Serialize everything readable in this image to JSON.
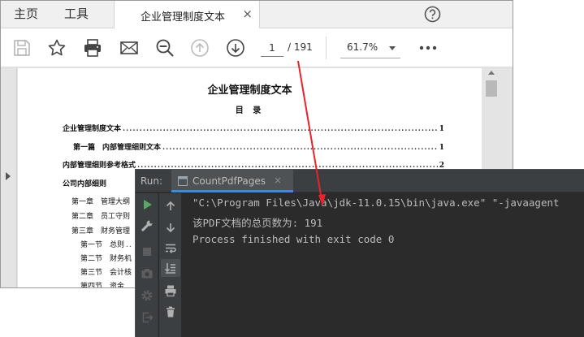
{
  "pdf_reader": {
    "menu": {
      "home_label": "主页",
      "tools_label": "工具"
    },
    "tab": {
      "title": "企业管理制度文本",
      "close_glyph": "×"
    },
    "toolbar": {
      "page_current": "1",
      "page_total": "/ 191",
      "zoom": "61.7%"
    },
    "document": {
      "title": "企业管理制度文本",
      "subtitle": "目 录",
      "toc": [
        {
          "text": "企业管理制度文本",
          "dots": "..........................................................................................................................................",
          "page": "1"
        },
        {
          "text": "第一篇　内部管理细则文本",
          "dots": "..........................................................................................................................................",
          "page": "1"
        },
        {
          "text": "内部管理细则参考格式",
          "dots": "..........................................................................................................................................",
          "page": "2"
        },
        {
          "text": "公司内部细则",
          "dots": "",
          "page": ""
        },
        {
          "text": "第一章　管理大纲",
          "dots": "",
          "page": ""
        },
        {
          "text": "第二章　员工守则",
          "dots": "",
          "page": ""
        },
        {
          "text": "第三章　财务管理",
          "dots": "",
          "page": ""
        },
        {
          "text": "第一节　总则",
          "dots": "..",
          "page": ""
        },
        {
          "text": "第二节　财务机",
          "dots": "",
          "page": ""
        },
        {
          "text": "第三节　会计核",
          "dots": "",
          "page": ""
        },
        {
          "text": "第四节　资金",
          "dots": "",
          "page": ""
        }
      ]
    }
  },
  "run_panel": {
    "label": "Run:",
    "tab_title": "CountPdfPages",
    "tab_close": "×",
    "console_lines": [
      "\"C:\\Program Files\\Java\\jdk-11.0.15\\bin\\java.exe\" \"-javaagent",
      "该PDF文档的总页数为: 191",
      "Process finished with exit code 0"
    ]
  },
  "colors": {
    "annotation_arrow": "#e8232a",
    "ide_background": "#2b2b2b",
    "ide_panel": "#3c3f41",
    "run_green": "#59a869"
  }
}
